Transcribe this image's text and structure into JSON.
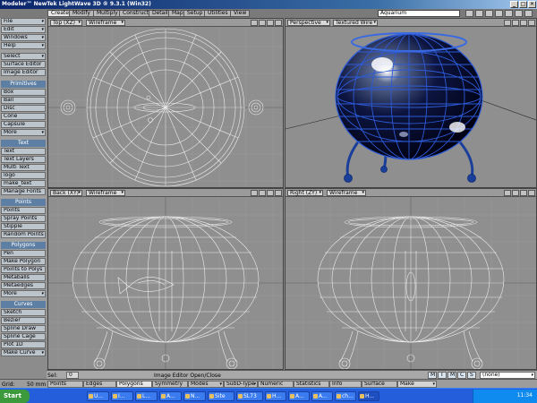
{
  "window": {
    "title": "Modeler™ NewTek LightWave 3D ® 9.3.1 (Win32)",
    "controls": [
      "_",
      "□",
      "✕"
    ]
  },
  "tabs": [
    "Create",
    "Modify",
    "Multiply",
    "Construct",
    "Detail",
    "Map",
    "Setup",
    "Utilities",
    "View"
  ],
  "active_tab": "Create",
  "preset": "Aquarium",
  "sidebar": {
    "menus": [
      "File",
      "Edit",
      "Windows",
      "Help"
    ],
    "tools": [
      "Select",
      "Surface Editor",
      "Image Editor"
    ],
    "sections": [
      {
        "title": "Primitives",
        "items": [
          "Box",
          "Ball",
          "Disc",
          "Cone",
          "Capsule",
          "More"
        ]
      },
      {
        "title": "Text",
        "items": [
          "Text",
          "Text Layers",
          "Multi Text",
          "logo",
          "make_text",
          "Manage Fonts"
        ]
      },
      {
        "title": "Points",
        "items": [
          "Points",
          "Spray Points",
          "Stipple",
          "Random Points"
        ]
      },
      {
        "title": "Polygons",
        "items": [
          "Pen",
          "Make Polygon",
          "Points to Polys",
          "Metaballs",
          "Metaedges",
          "More"
        ]
      },
      {
        "title": "Curves",
        "items": [
          "Sketch",
          "Bezier",
          "Spline Draw",
          "Spline Cage",
          "Plot 1D",
          "Make Curve"
        ]
      }
    ]
  },
  "viewports": [
    {
      "view": "Top",
      "axis": "(XZ)",
      "mode": "Wireframe"
    },
    {
      "view": "Perspective",
      "axis": "",
      "mode": "Textured Wire"
    },
    {
      "view": "Back",
      "axis": "(XY)",
      "mode": "Wireframe"
    },
    {
      "view": "Right",
      "axis": "(ZY)",
      "mode": "Wireframe"
    }
  ],
  "status": {
    "sel_label": "Sel:",
    "sel_value": "0",
    "message": "Image Editor Open/Close",
    "layer_buttons": [
      "M",
      "T",
      "M",
      "C",
      "S"
    ],
    "layer_select": "(none)"
  },
  "bottom": {
    "grid_label": "Grid:",
    "grid_value": "50 mm",
    "modes": [
      "Points",
      "Edges",
      "Polygons",
      "Symmetry",
      "Modes",
      "SubD-Type",
      "Numeric",
      "Statistics",
      "Info",
      "Surface",
      "Make"
    ]
  },
  "taskbar": {
    "start": "Start",
    "items": [
      "U...",
      "I...",
      "L...",
      "A...",
      "N...",
      "Site",
      "SL73",
      "H...",
      "A...",
      "A...",
      "ch...",
      "H..."
    ],
    "clock": "11:34"
  },
  "colors": {
    "accent": "#5d7fa4",
    "mesh_blue": "#1a3f9a",
    "wire_gray": "#e6e6e6"
  }
}
